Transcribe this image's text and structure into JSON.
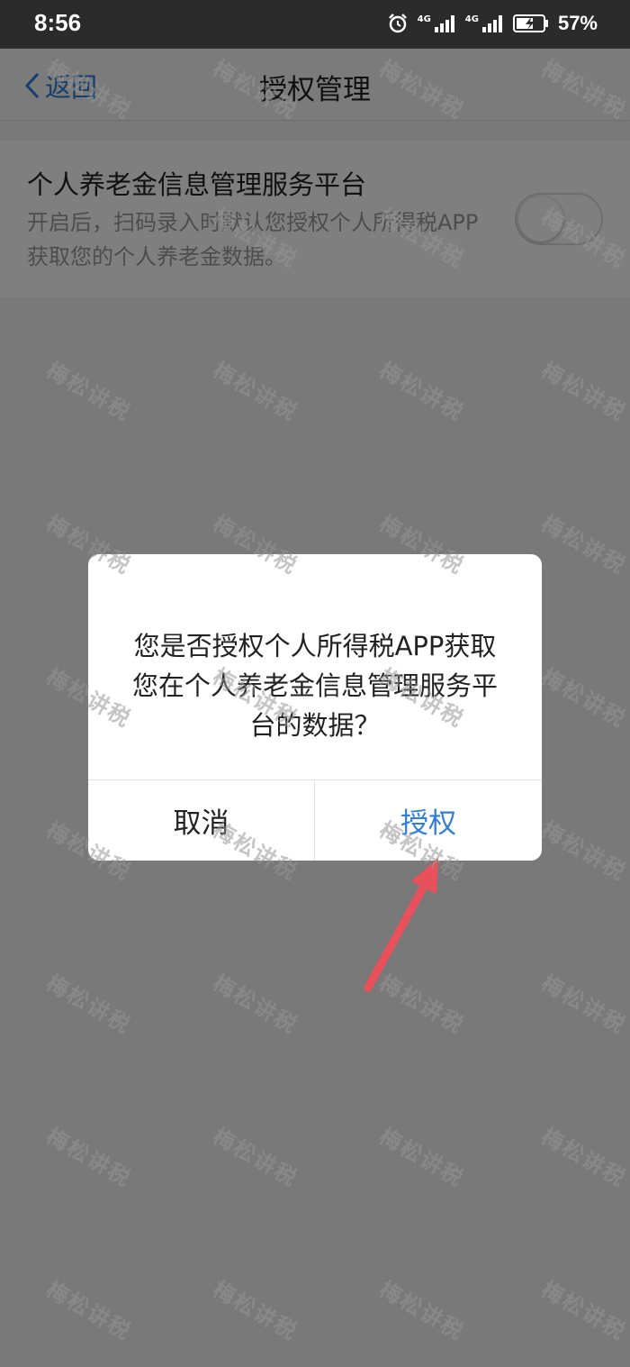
{
  "status_bar": {
    "time": "8:56",
    "battery_percent": "57%",
    "icons": [
      "alarm-icon",
      "signal-4g-icon",
      "signal-4g-icon",
      "battery-charging-icon"
    ],
    "network_labels": [
      "4G",
      "4G"
    ]
  },
  "nav": {
    "back_label": "返回",
    "title": "授权管理"
  },
  "setting": {
    "title": "个人养老金信息管理服务平台",
    "description": "开启后，扫码录入时默认您授权个人所得税APP获取您的个人养老金数据。",
    "toggle_on": false
  },
  "dialog": {
    "message": "您是否授权个人所得税APP获取您在个人养老金信息管理服务平台的数据？",
    "cancel_label": "取消",
    "authorize_label": "授权"
  },
  "watermark": {
    "text": "梅松讲税"
  },
  "colors": {
    "accent": "#2f7fd7",
    "arrow": "#e8505b",
    "overlay": "rgba(0,0,0,0.5)"
  }
}
